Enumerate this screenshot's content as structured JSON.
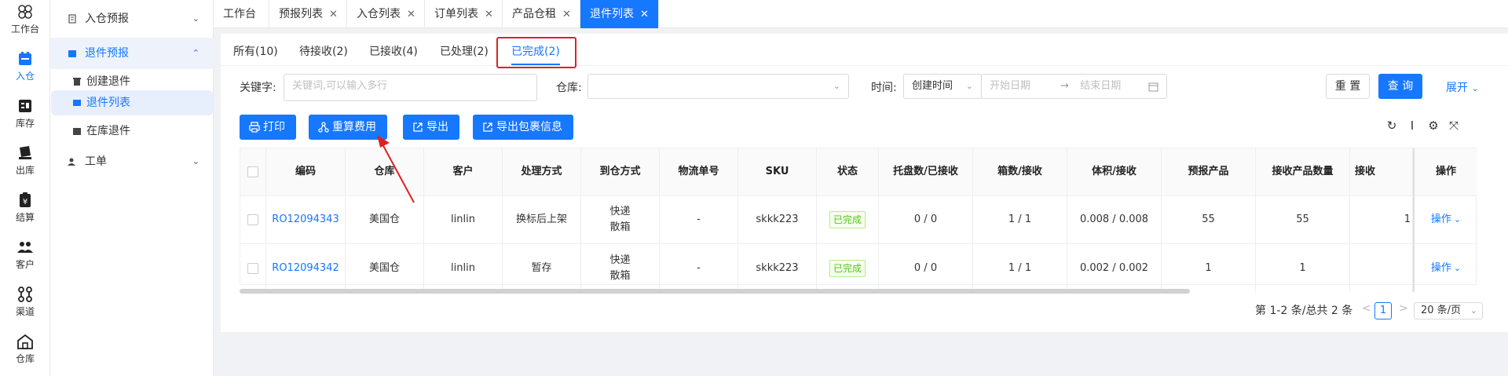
{
  "rail": [
    {
      "label": "工作台",
      "icon": "workbench-icon"
    },
    {
      "label": "入仓",
      "icon": "inbound-icon",
      "active": true
    },
    {
      "label": "库存",
      "icon": "inventory-icon"
    },
    {
      "label": "出库",
      "icon": "outbound-icon"
    },
    {
      "label": "结算",
      "icon": "settlement-icon"
    },
    {
      "label": "客户",
      "icon": "customer-icon"
    },
    {
      "label": "渠道",
      "icon": "channel-icon"
    },
    {
      "label": "仓库",
      "icon": "warehouse-icon"
    }
  ],
  "subnav": {
    "inbound_forecast": "入仓预报",
    "return_forecast": "退件预报",
    "create_return": "创建退件",
    "return_list": "退件列表",
    "instock_return": "在库退件",
    "work_order": "工单"
  },
  "top_tabs": [
    {
      "label": "工作台",
      "closable": false
    },
    {
      "label": "预报列表",
      "closable": true
    },
    {
      "label": "入仓列表",
      "closable": true
    },
    {
      "label": "订单列表",
      "closable": true
    },
    {
      "label": "产品仓租",
      "closable": true
    },
    {
      "label": "退件列表",
      "closable": true,
      "active": true
    }
  ],
  "status_tabs": [
    {
      "label": "所有(10)"
    },
    {
      "label": "待接收(2)"
    },
    {
      "label": "已接收(4)"
    },
    {
      "label": "已处理(2)"
    },
    {
      "label": "已完成(2)",
      "active": true
    }
  ],
  "filters": {
    "keyword_label": "关键字:",
    "keyword_placeholder": "关键词,可以输入多行",
    "warehouse_label": "仓库:",
    "warehouse_value": "",
    "time_label": "时间:",
    "time_type": "创建时间",
    "start_placeholder": "开始日期",
    "end_placeholder": "结束日期",
    "reset": "重 置",
    "query": "查 询",
    "expand": "展开"
  },
  "actions": {
    "print": "打印",
    "recalc": "重算费用",
    "export": "导出",
    "export_pkg": "导出包裹信息"
  },
  "table": {
    "headers": [
      "编码",
      "仓库",
      "客户",
      "处理方式",
      "到仓方式",
      "物流单号",
      "SKU",
      "状态",
      "托盘数/已接收",
      "箱数/接收",
      "体积/接收",
      "预报产品",
      "接收产品数量",
      "接收",
      "操作"
    ],
    "rows": [
      {
        "code": "RO12094343",
        "warehouse": "美国仓",
        "customer": "linlin",
        "handling": "换标后上架",
        "arrival1": "快递",
        "arrival2": "散箱",
        "tracking": "-",
        "sku": "skkk223",
        "status": "已完成",
        "pallets": "0 / 0",
        "boxes": "1 / 1",
        "volume": "0.008 / 0.008",
        "forecast": "55",
        "received": "55",
        "extra": "1",
        "op": "操作"
      },
      {
        "code": "RO12094342",
        "warehouse": "美国仓",
        "customer": "linlin",
        "handling": "暂存",
        "arrival1": "快递",
        "arrival2": "散箱",
        "tracking": "-",
        "sku": "skkk223",
        "status": "已完成",
        "pallets": "0 / 0",
        "boxes": "1 / 1",
        "volume": "0.002 / 0.002",
        "forecast": "1",
        "received": "1",
        "extra": "",
        "op": "操作"
      }
    ]
  },
  "pagination": {
    "summary": "第 1-2 条/总共 2 条",
    "prev": "<",
    "page": "1",
    "next": ">",
    "page_size": "20 条/页"
  },
  "colors": {
    "primary": "#1677ff",
    "highlight_box": "#e02020",
    "success": "#52c41a"
  }
}
